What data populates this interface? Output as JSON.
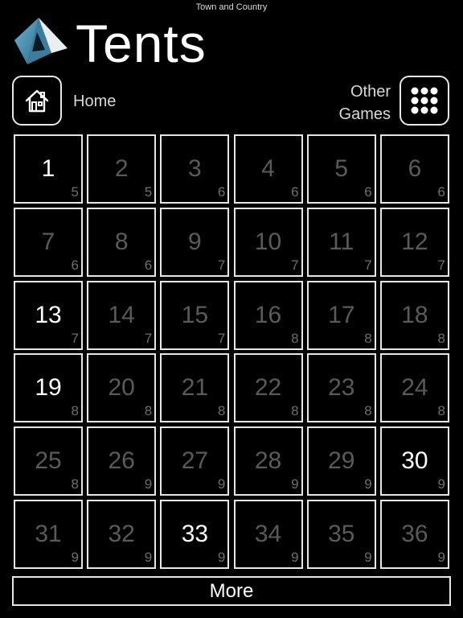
{
  "header": {
    "top_label": "Town and Country",
    "title": "Tents"
  },
  "nav": {
    "home_label": "Home",
    "other_games_line1": "Other",
    "other_games_line2": "Games"
  },
  "levels": [
    {
      "number": "1",
      "size": "5",
      "unlocked": true
    },
    {
      "number": "2",
      "size": "5",
      "unlocked": false
    },
    {
      "number": "3",
      "size": "6",
      "unlocked": false
    },
    {
      "number": "4",
      "size": "6",
      "unlocked": false
    },
    {
      "number": "5",
      "size": "6",
      "unlocked": false
    },
    {
      "number": "6",
      "size": "6",
      "unlocked": false
    },
    {
      "number": "7",
      "size": "6",
      "unlocked": false
    },
    {
      "number": "8",
      "size": "6",
      "unlocked": false
    },
    {
      "number": "9",
      "size": "7",
      "unlocked": false
    },
    {
      "number": "10",
      "size": "7",
      "unlocked": false
    },
    {
      "number": "11",
      "size": "7",
      "unlocked": false
    },
    {
      "number": "12",
      "size": "7",
      "unlocked": false
    },
    {
      "number": "13",
      "size": "7",
      "unlocked": true
    },
    {
      "number": "14",
      "size": "7",
      "unlocked": false
    },
    {
      "number": "15",
      "size": "7",
      "unlocked": false
    },
    {
      "number": "16",
      "size": "8",
      "unlocked": false
    },
    {
      "number": "17",
      "size": "8",
      "unlocked": false
    },
    {
      "number": "18",
      "size": "8",
      "unlocked": false
    },
    {
      "number": "19",
      "size": "8",
      "unlocked": true
    },
    {
      "number": "20",
      "size": "8",
      "unlocked": false
    },
    {
      "number": "21",
      "size": "8",
      "unlocked": false
    },
    {
      "number": "22",
      "size": "8",
      "unlocked": false
    },
    {
      "number": "23",
      "size": "8",
      "unlocked": false
    },
    {
      "number": "24",
      "size": "8",
      "unlocked": false
    },
    {
      "number": "25",
      "size": "8",
      "unlocked": false
    },
    {
      "number": "26",
      "size": "9",
      "unlocked": false
    },
    {
      "number": "27",
      "size": "9",
      "unlocked": false
    },
    {
      "number": "28",
      "size": "9",
      "unlocked": false
    },
    {
      "number": "29",
      "size": "9",
      "unlocked": false
    },
    {
      "number": "30",
      "size": "9",
      "unlocked": true
    },
    {
      "number": "31",
      "size": "9",
      "unlocked": false
    },
    {
      "number": "32",
      "size": "9",
      "unlocked": false
    },
    {
      "number": "33",
      "size": "9",
      "unlocked": true
    },
    {
      "number": "34",
      "size": "9",
      "unlocked": false
    },
    {
      "number": "35",
      "size": "9",
      "unlocked": false
    },
    {
      "number": "36",
      "size": "9",
      "unlocked": false
    }
  ],
  "footer": {
    "more_label": "More"
  },
  "icons": {
    "logo": "tent-logo-icon",
    "home": "house-icon",
    "games": "nine-dot-grid-icon"
  },
  "colors": {
    "background": "#000000",
    "unlocked_text": "#ffffff",
    "locked_text": "#5a5a5a",
    "border": "#e6e6e6",
    "logo_accent": "#4a8fb0"
  }
}
